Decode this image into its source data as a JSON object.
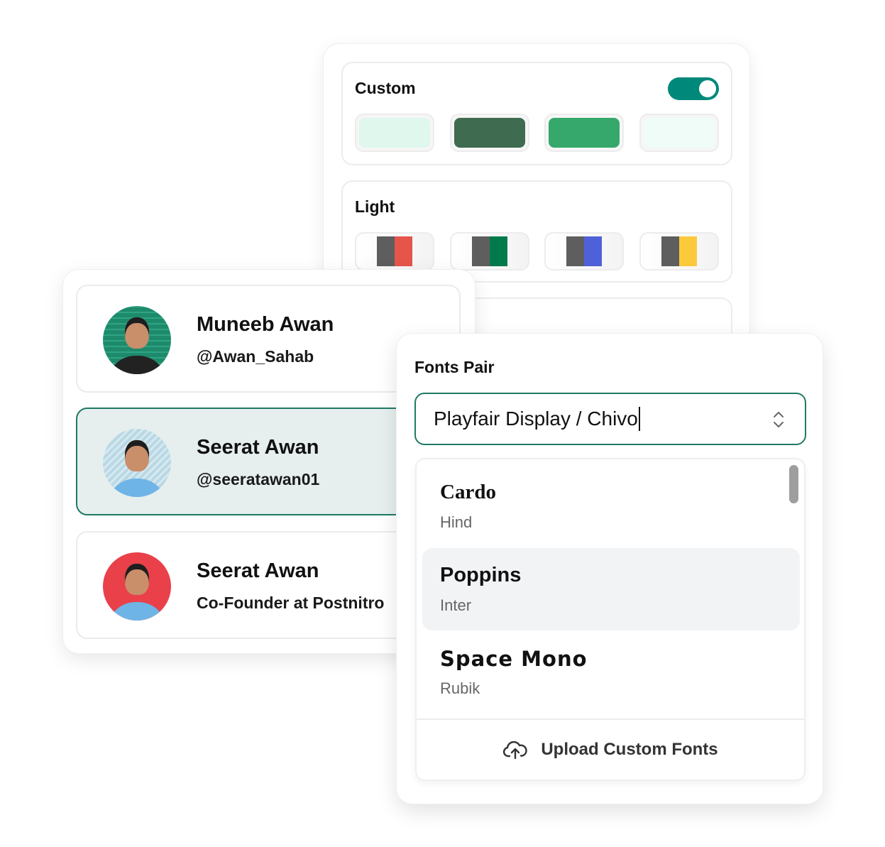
{
  "theme_panel": {
    "custom": {
      "title": "Custom",
      "toggle_on": true,
      "toggle_color": "#00897b",
      "swatches": [
        {
          "name": "mint-light",
          "color": "#dff7ec"
        },
        {
          "name": "forest",
          "color": "#3f6b51"
        },
        {
          "name": "emerald",
          "color": "#36a86c"
        },
        {
          "name": "mint-faint",
          "color": "#effcf7"
        }
      ]
    },
    "light": {
      "title": "Light",
      "swatches": [
        {
          "name": "gray-red",
          "colors": [
            "#5e5e5e",
            "#e5554a"
          ]
        },
        {
          "name": "gray-green",
          "colors": [
            "#5e5e5e",
            "#007a4a"
          ]
        },
        {
          "name": "gray-blue",
          "colors": [
            "#5e5e5e",
            "#4f61d8"
          ]
        },
        {
          "name": "gray-yellow",
          "colors": [
            "#5e5e5e",
            "#fbc93b"
          ]
        }
      ]
    }
  },
  "profiles": [
    {
      "name": "Muneeb Awan",
      "sub": "@Awan_Sahab",
      "selected": false,
      "avatar_bg": "green"
    },
    {
      "name": "Seerat Awan",
      "sub": "@seeratawan01",
      "selected": true,
      "avatar_bg": "blue"
    },
    {
      "name": "Seerat Awan",
      "sub": "Co-Founder at Postnitro",
      "selected": false,
      "avatar_bg": "red"
    }
  ],
  "fonts_panel": {
    "title": "Fonts Pair",
    "select_value": "Playfair Display / Chivo",
    "options": [
      {
        "primary": "Cardo",
        "secondary": "Hind",
        "highlighted": false
      },
      {
        "primary": "Poppins",
        "secondary": "Inter",
        "highlighted": true
      },
      {
        "primary": "Space Mono",
        "secondary": "Rubik",
        "highlighted": false
      }
    ],
    "upload_label": "Upload Custom Fonts",
    "accent_color": "#1f7a65"
  }
}
